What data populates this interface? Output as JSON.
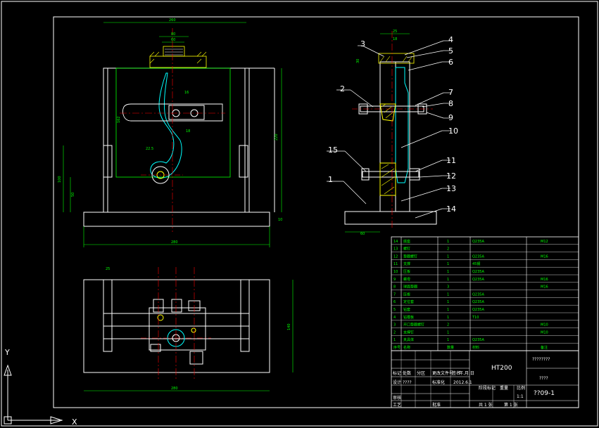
{
  "drawing": {
    "drawing_number": "??09-1",
    "drawing_name": "????????",
    "sub_name": "????",
    "material": "HT200",
    "scale": "1:1",
    "sheet_label": "第 1 张",
    "sheet_total_label": "共 1 张"
  },
  "callouts": {
    "right_side": [
      "4",
      "5",
      "6",
      "7",
      "8",
      "9",
      "10",
      "11",
      "12",
      "13",
      "14"
    ],
    "left_side": [
      "3",
      "2",
      "15",
      "1"
    ]
  },
  "dimensions": {
    "front_width": "260",
    "front_top": "80",
    "front_top2": "60",
    "front_height": "220",
    "front_162": "162",
    "front_16": "16",
    "front_22_5": "22.5",
    "front_18": "18",
    "front_100": "100",
    "front_50": "50",
    "front_10": "10",
    "front_base": "280",
    "side_25": "25",
    "side_18": "18",
    "side_30": "30",
    "side_60": "60",
    "top_25": "25",
    "top_140": "140",
    "top_280": "280"
  },
  "bom": {
    "rows": [
      {
        "no": "14",
        "name": "底座",
        "qty": "1",
        "material": "Q235A",
        "note": "M12"
      },
      {
        "no": "13",
        "name": "螺钉",
        "qty": "2",
        "material": "",
        "note": ""
      },
      {
        "no": "12",
        "name": "垫圈螺钉",
        "qty": "1",
        "material": "Q235A",
        "note": "M16"
      },
      {
        "no": "11",
        "name": "支撑",
        "qty": "1",
        "material": "45钢",
        "note": ""
      },
      {
        "no": "10",
        "name": "压板",
        "qty": "1",
        "material": "Q235A",
        "note": ""
      },
      {
        "no": "9",
        "name": "螺母",
        "qty": "1",
        "material": "Q235A",
        "note": "M16"
      },
      {
        "no": "8",
        "name": "球面垫圈",
        "qty": "3",
        "material": "",
        "note": "M16"
      },
      {
        "no": "7",
        "name": "压板",
        "qty": "1",
        "material": "Q235A",
        "note": ""
      },
      {
        "no": "6",
        "name": "定位套",
        "qty": "1",
        "material": "Q235A",
        "note": ""
      },
      {
        "no": "5",
        "name": "钻套",
        "qty": "1",
        "material": "Q235A",
        "note": ""
      },
      {
        "no": "4",
        "name": "钻模板",
        "qty": "1",
        "material": "T10",
        "note": ""
      },
      {
        "no": "3",
        "name": "开口垫圈螺钉",
        "qty": "2",
        "material": "",
        "note": "M10"
      },
      {
        "no": "2",
        "name": "支撑钉",
        "qty": "1",
        "material": "",
        "note": "M10"
      },
      {
        "no": "1",
        "name": "夹具体",
        "qty": "1",
        "material": "Q235A",
        "note": ""
      }
    ],
    "header": {
      "no": "序号",
      "name": "名称",
      "qty": "数量",
      "material": "材料",
      "note": "备注"
    }
  },
  "title_block": {
    "row1": [
      "标记",
      "处数",
      "分区",
      "更改文件号",
      "签名",
      "年.月.日"
    ],
    "row2": [
      "设计",
      "????",
      "标准化",
      "2012.6.1"
    ],
    "row3": [
      "审核",
      "",
      "",
      "",
      "阶段标记",
      "重量",
      "比例"
    ],
    "row4": [
      "工艺",
      "",
      "批准",
      "",
      "共 1 张",
      "第 1 张"
    ]
  },
  "colors": {
    "background": "#000000",
    "frame": "#ffffff",
    "dimension": "#00ff00",
    "centerline": "#ff0000",
    "part": "#00ffff",
    "hatch": "#ffff00",
    "bolt": "#ffffff"
  },
  "ucs": {
    "x_label": "X",
    "y_label": "Y"
  }
}
